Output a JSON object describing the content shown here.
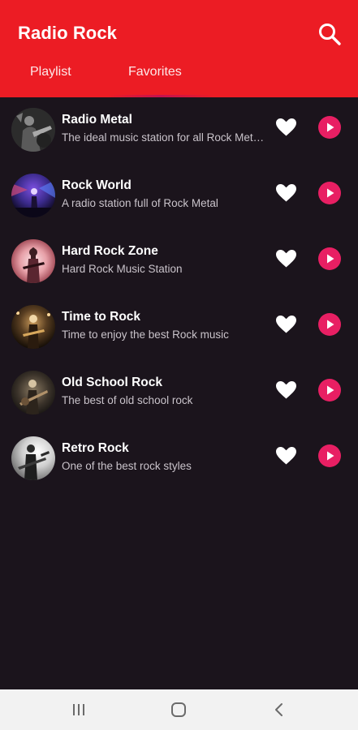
{
  "app": {
    "title": "Radio Rock",
    "colors": {
      "app_bar": "#ec1c24",
      "accent": "#e81f63",
      "background": "#1b141c"
    }
  },
  "header": {
    "search_icon": "search-icon",
    "tabs": [
      {
        "label": "Playlist"
      },
      {
        "label": "Favorites"
      }
    ]
  },
  "stations": [
    {
      "name": "Radio Metal",
      "description": "The ideal music station for all Rock Metal lovers",
      "favorite_icon": "heart-icon",
      "action_icon": "play-icon"
    },
    {
      "name": "Rock World",
      "description": "A radio station full of Rock Metal",
      "favorite_icon": "heart-icon",
      "action_icon": "play-icon"
    },
    {
      "name": "Hard Rock Zone",
      "description": "Hard Rock Music Station",
      "favorite_icon": "heart-icon",
      "action_icon": "play-icon"
    },
    {
      "name": "Time to Rock",
      "description": "Time to enjoy the best Rock music",
      "favorite_icon": "heart-icon",
      "action_icon": "play-icon"
    },
    {
      "name": "Old School Rock",
      "description": "The best of old school rock",
      "favorite_icon": "heart-icon",
      "action_icon": "play-icon"
    },
    {
      "name": "Retro Rock",
      "description": "One of the best rock styles",
      "favorite_icon": "heart-icon",
      "action_icon": "play-icon"
    }
  ],
  "system_nav": {
    "buttons": [
      "recents-icon",
      "home-icon",
      "back-icon"
    ]
  }
}
